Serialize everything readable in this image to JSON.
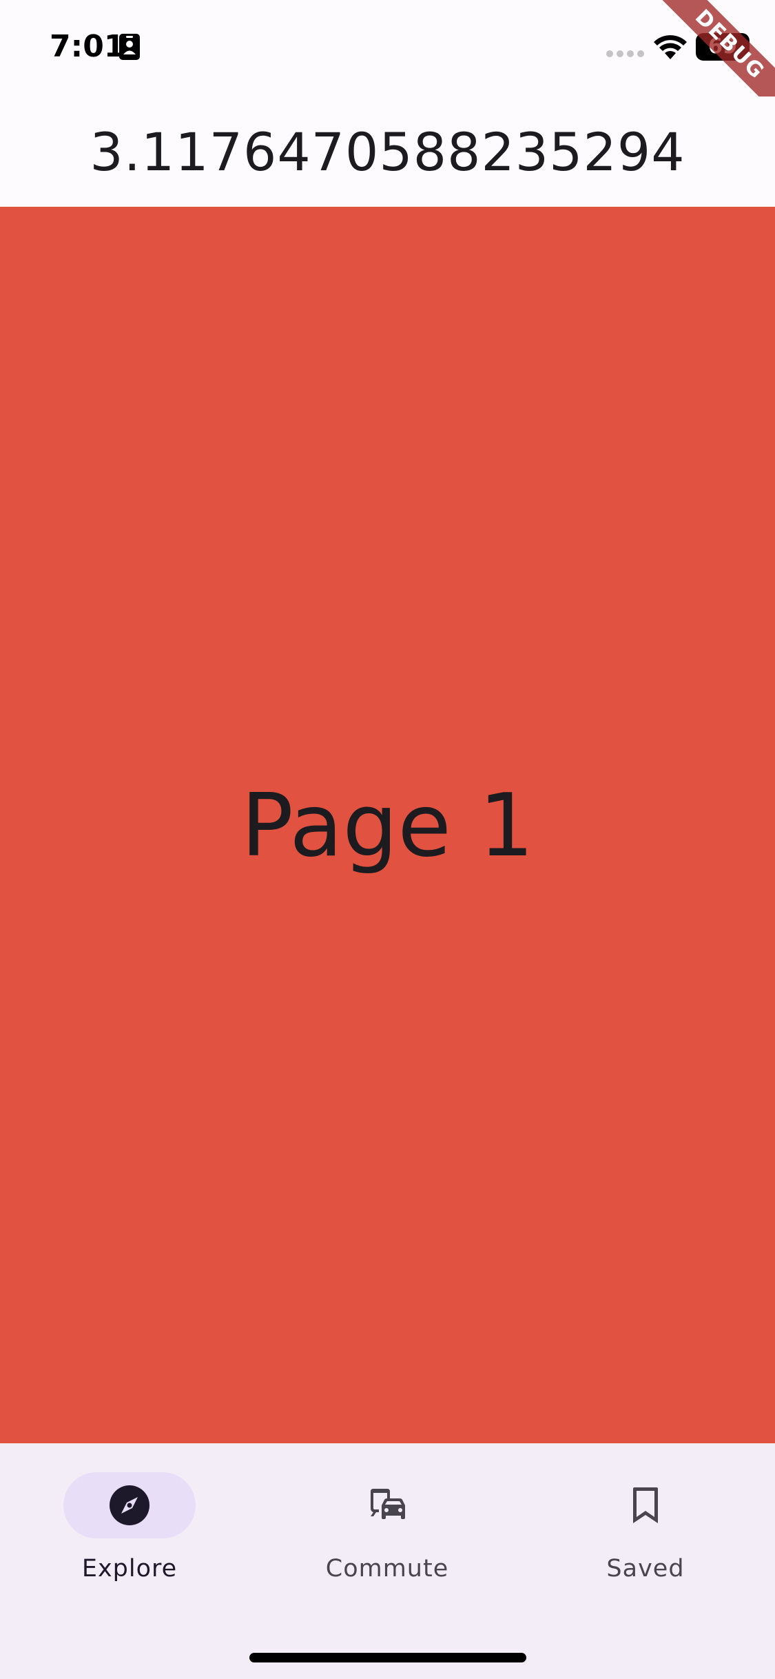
{
  "status_bar": {
    "time": "7:01",
    "battery": "69"
  },
  "debug_banner": {
    "label": "DEBUG"
  },
  "app_bar": {
    "title": "3.1176470588235294"
  },
  "page": {
    "label": "Page 1",
    "background_color": "#e15241"
  },
  "bottom_nav": {
    "items": [
      {
        "label": "Explore",
        "icon": "compass-icon",
        "active": true
      },
      {
        "label": "Commute",
        "icon": "commute-icon",
        "active": false
      },
      {
        "label": "Saved",
        "icon": "bookmark-icon",
        "active": false
      }
    ],
    "indicator_color": "#e8def8",
    "background_color": "#f3edf7"
  }
}
